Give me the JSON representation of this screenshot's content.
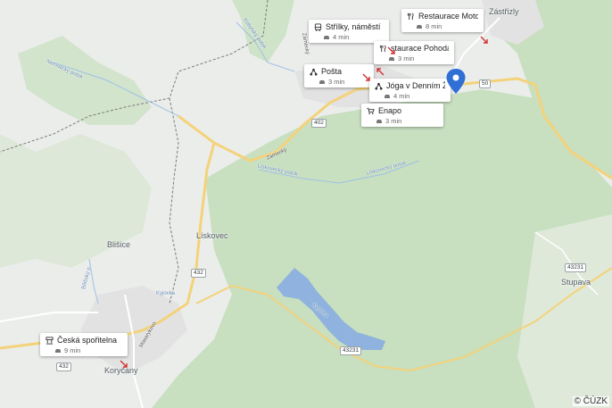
{
  "map": {
    "places": [
      {
        "name": "Zástřizly"
      },
      {
        "name": "Lískovec"
      },
      {
        "name": "Blišice"
      },
      {
        "name": "Stupava"
      },
      {
        "name": "Koryčany"
      }
    ],
    "water_labels": [
      {
        "name": "Kobylský potok"
      },
      {
        "name": "Nemotický potok"
      },
      {
        "name": "Zámecký"
      },
      {
        "name": "Lískovecký potok"
      },
      {
        "name": "Lískovecký potok"
      },
      {
        "name": "Bílišský p."
      },
      {
        "name": "Kyjovka"
      },
      {
        "name": "Kyjovka"
      },
      {
        "name": "Zámecký"
      },
      {
        "name": "Masarykovo"
      }
    ],
    "road_numbers": [
      "402",
      "432",
      "50",
      "43231",
      "43231",
      "432"
    ],
    "colors": {
      "forest": "#c8dfc0",
      "open_land": "#e9ece9",
      "water": "#8fb3de",
      "road_primary": "#f4d27a",
      "road_minor": "#ffffff",
      "border": "#6e6e6e",
      "pin": "#2f6fd6"
    },
    "copyright": "© ČÚZK"
  },
  "pois": [
    {
      "title": "Střílky, náměstí",
      "time": "4 min",
      "icon": "bus-icon"
    },
    {
      "title": "Restaurace Moto…",
      "time": "8 min",
      "icon": "restaurant-icon"
    },
    {
      "title": "staurace Pohoda",
      "time": "3 min",
      "icon": "restaurant-icon"
    },
    {
      "title": "Pošta",
      "time": "3 min",
      "icon": "post-office-icon"
    },
    {
      "title": "Jóga v Denním Živ…",
      "time": "4 min",
      "icon": "yoga-icon"
    },
    {
      "title": "Enapo",
      "time": "3 min",
      "icon": "shopping-cart-icon"
    },
    {
      "title": "Česká spořitelna",
      "time": "9 min",
      "icon": "bank-icon"
    }
  ],
  "selected_location": {
    "icon": "location-pin-icon"
  }
}
